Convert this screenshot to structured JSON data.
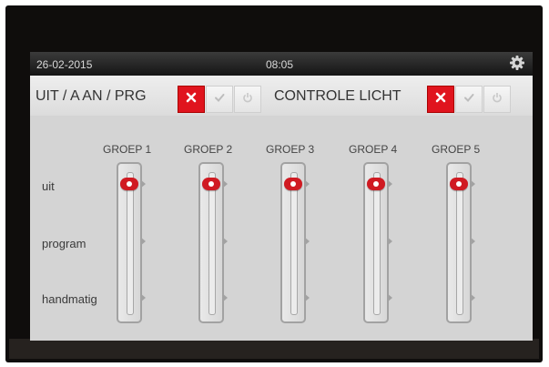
{
  "status": {
    "date": "26-02-2015",
    "time": "08:05",
    "settings_icon": "gear-icon"
  },
  "header": {
    "mode_label": "UIT / A AN / PRG",
    "light_label": "CONTROLE LICHT",
    "buttons": [
      "close-icon",
      "checkmark-icon",
      "power-icon"
    ],
    "active_color": "#e0141e"
  },
  "groups": [
    {
      "name": "GROEP 1",
      "position": "uit"
    },
    {
      "name": "GROEP 2",
      "position": "uit"
    },
    {
      "name": "GROEP 3",
      "position": "uit"
    },
    {
      "name": "GROEP 4",
      "position": "uit"
    },
    {
      "name": "GROEP 5",
      "position": "uit"
    }
  ],
  "rows": [
    "uit",
    "program",
    "handmatig"
  ]
}
